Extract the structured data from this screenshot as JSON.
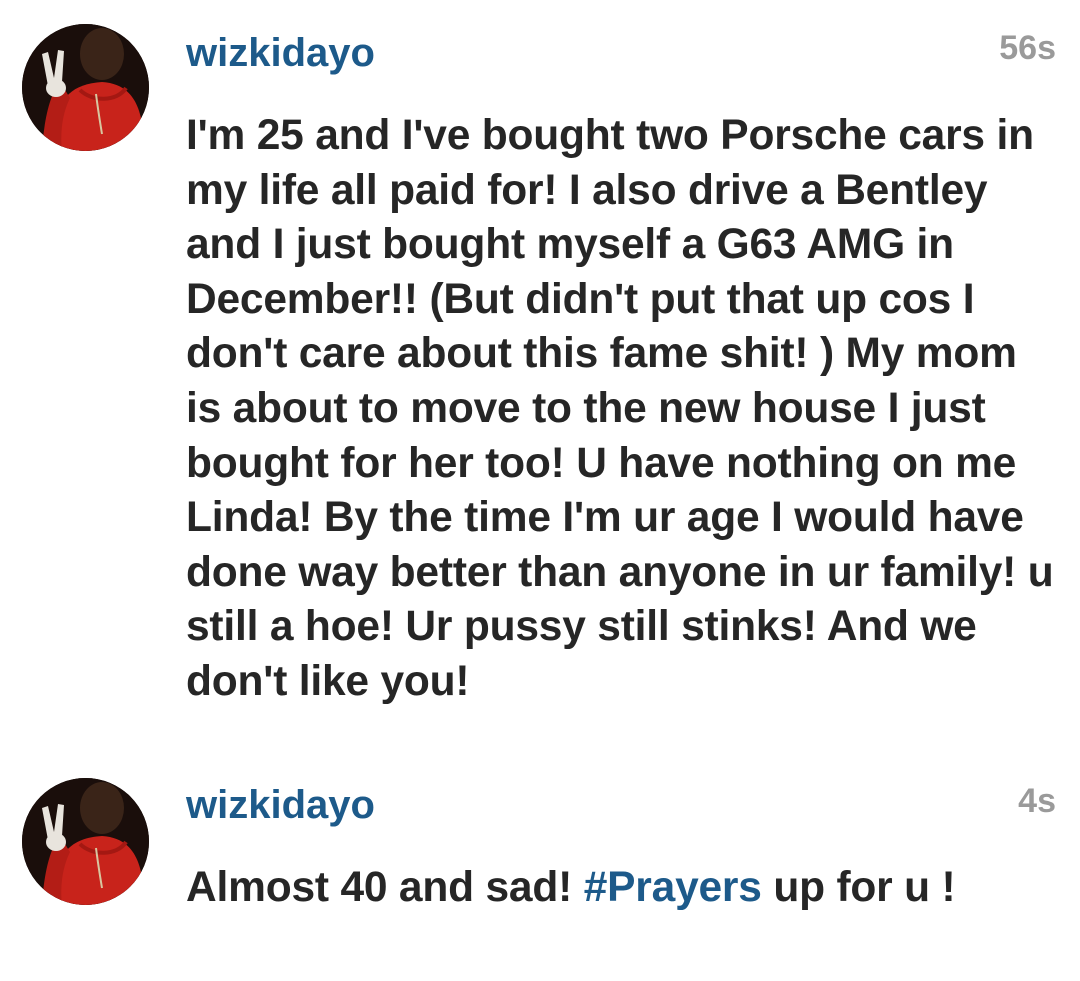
{
  "comments": [
    {
      "username": "wizkidayo",
      "timestamp": "56s",
      "text": "I'm 25 and I've bought two Porsche cars in my life all paid for! I also drive a Bentley and I just bought myself a G63 AMG in December!! (But didn't put that up cos I don't care about this fame shit! ) My mom is about to move to the new house I just bought for her too! U have nothing on me Linda! By the time I'm ur age I would have done way better than anyone in ur family! u still a hoe! Ur pussy still stinks! And we don't like you!"
    },
    {
      "username": "wizkidayo",
      "timestamp": "4s",
      "text_before": "Almost 40 and sad! ",
      "hashtag": "#Prayers",
      "text_after": " up for u !"
    }
  ],
  "colors": {
    "username": "#1d5a8a",
    "hashtag": "#1d5a8a",
    "body_text": "#262626",
    "timestamp": "#9a9a9a",
    "avatar_shirt": "#c8231b"
  }
}
